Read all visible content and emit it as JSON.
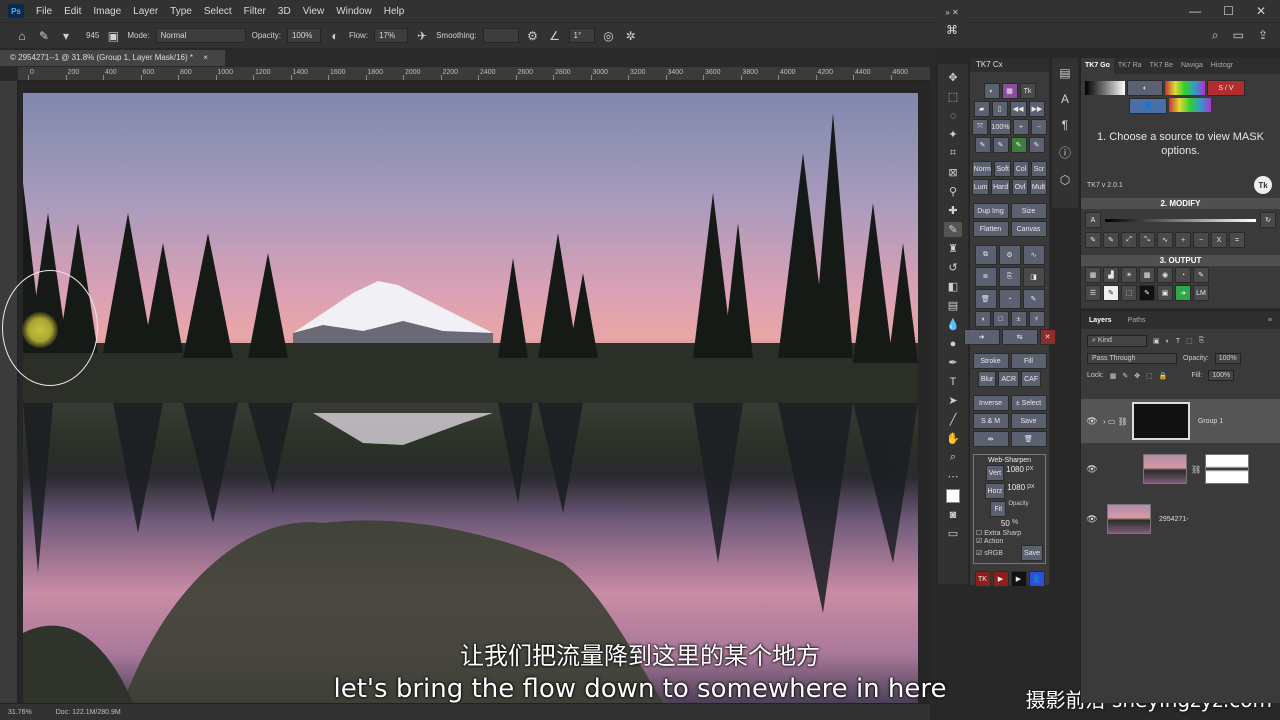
{
  "app": {
    "logo": "Ps"
  },
  "menu": [
    "File",
    "Edit",
    "Image",
    "Layer",
    "Type",
    "Select",
    "Filter",
    "3D",
    "View",
    "Window",
    "Help"
  ],
  "options_bar": {
    "brush_size": "945",
    "mode_label": "Mode:",
    "mode_value": "Normal",
    "opacity_label": "Opacity:",
    "opacity_value": "100%",
    "flow_label": "Flow:",
    "flow_value": "17%",
    "smoothing_label": "Smoothing:",
    "smoothing_value": "",
    "angle_value": "1°"
  },
  "document_tab": {
    "title": "© 2954271--1 @ 31.8% (Group 1, Layer Mask/16) *",
    "close": "×"
  },
  "ruler_ticks": [
    "0",
    "200",
    "400",
    "600",
    "800",
    "1000",
    "1200",
    "1400",
    "1600",
    "1800",
    "2000",
    "2200",
    "2400",
    "2600",
    "2800",
    "3000",
    "3200",
    "3400",
    "3600",
    "3800",
    "4000",
    "4200",
    "4400",
    "4600",
    "4800"
  ],
  "status_bar": {
    "zoom": "31.76%",
    "doc": "Doc: 122.1M/280.9M"
  },
  "subtitles": {
    "chinese": "让我们把流量降到这里的某个地方",
    "english": "let's bring the flow down to somewhere in here"
  },
  "watermark": "摄影前沿 sheyingzyz.com",
  "tk7cx": {
    "title": "TK7 Cx",
    "blend_buttons": [
      "Norm",
      "Soft",
      "Col",
      "Scr",
      "Lum",
      "Hard",
      "Ovl",
      "Mult"
    ],
    "percent_label": "100%",
    "btn_dup_img": "Dup Img",
    "btn_size": "Size",
    "btn_flatten": "Flatten",
    "btn_canvas": "Canvas",
    "btn_stroke": "Stroke",
    "btn_fill": "Fill",
    "btn_blur": "Blur",
    "btn_acr": "ACR",
    "btn_caf": "CAF",
    "btn_inverse": "Inverse",
    "btn_select": "± Select",
    "btn_sm": "S & M",
    "btn_save": "Save",
    "web_sharpen": {
      "title": "Web-Sharpen",
      "vert_label": "Vert",
      "vert_value": "1080",
      "horz_label": "Horz",
      "horz_value": "1080",
      "unit": "px",
      "fit_label": "Fit",
      "opacity_label": "Opacity",
      "opacity_value": "50",
      "percent": "%",
      "extra_sharp": "Extra Sharp",
      "action": "Action",
      "srgb": "sRGB",
      "save": "Save"
    },
    "footer_logo": "TK"
  },
  "right_panel": {
    "tabs": [
      "TK7 Go",
      "TK7 Ra",
      "TK7 Be",
      "Naviga",
      "Histogr"
    ],
    "sv_label": "S / V",
    "instruction": "1. Choose a source to view MASK options.",
    "version": "TK7 v 2.0.1",
    "modify_title": "2. MODIFY",
    "modify_a": "A",
    "output_title": "3. OUTPUT",
    "output_lm": "LM",
    "ops": [
      "+",
      "−",
      "X",
      "="
    ]
  },
  "layers_panel": {
    "tabs": [
      "Layers",
      "Paths"
    ],
    "filter_kind": "Kind",
    "blend_mode": "Pass Through",
    "opacity_label": "Opacity:",
    "opacity_value": "100%",
    "lock_label": "Lock:",
    "fill_label": "Fill:",
    "fill_value": "100%",
    "layers": [
      {
        "name": "Group 1",
        "type": "group-mask"
      },
      {
        "name": "",
        "type": "adjustment-with-mask"
      },
      {
        "name": "2954271-",
        "type": "image"
      }
    ]
  },
  "colors": {
    "ui_dark": "#323232",
    "panel": "#3a3a3a",
    "tk_button": "#5b6170",
    "sv_red": "#c0392b",
    "accent_green": "#2ea84a"
  }
}
